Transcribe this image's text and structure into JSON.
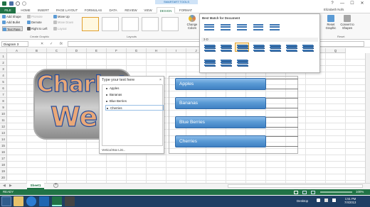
{
  "window": {
    "title": "Book1 - Excel",
    "context_tab_group": "SMARTART TOOLS",
    "user": "Elizabeth Nofs",
    "controls": [
      "?",
      "—",
      "☐",
      "✕"
    ]
  },
  "tabs": [
    "FILE",
    "HOME",
    "INSERT",
    "PAGE LAYOUT",
    "FORMULAS",
    "DATA",
    "REVIEW",
    "VIEW",
    "DESIGN",
    "FORMAT"
  ],
  "active_tab": "DESIGN",
  "ribbon": {
    "create_graphic": {
      "add_shape": "Add Shape",
      "add_bullet": "Add Bullet",
      "text_pane": "Text Pane",
      "promote": "Promote",
      "demote": "Demote",
      "right_to_left": "Right to Left",
      "layout": "Layout",
      "move_up": "Move Up",
      "move_down": "Move Down",
      "label": "Create Graphic"
    },
    "layouts_label": "Layouts",
    "change_colors": "Change Colors",
    "reset_graphic": "Reset Graphic",
    "convert_to_shapes": "Convert to Shapes",
    "reset_label": "Reset"
  },
  "styles_gallery": {
    "best_match_header": "Best Match for Document",
    "section_3d": "3-D"
  },
  "formula_bar": {
    "name_box": "Diagram 3",
    "fx": "fx",
    "cancel": "✕",
    "enter": "✓"
  },
  "columns": [
    "A",
    "B",
    "C",
    "D",
    "E",
    "F",
    "G",
    "H",
    "I",
    "J",
    "K",
    "L",
    "M",
    "N",
    "O",
    "P",
    "Q"
  ],
  "rows": [
    "1",
    "2",
    "3",
    "4",
    "5",
    "6",
    "7",
    "8",
    "9",
    "10",
    "11",
    "12",
    "13",
    "14",
    "15",
    "16",
    "17",
    "18",
    "19",
    "20"
  ],
  "logo_text": [
    "Charlott",
    "Webs"
  ],
  "text_pane": {
    "title": "Type your text here",
    "close": "×",
    "items": [
      "Apples",
      "Bananas",
      "Blue Berries",
      "Cherries"
    ],
    "footer": "Vertical Box List..."
  },
  "smartart": {
    "items": [
      "Apples",
      "Bananas",
      "Blue Berries",
      "Cherries"
    ]
  },
  "sheet": {
    "tab": "Sheet1",
    "add": "+"
  },
  "status": {
    "ready": "READY",
    "zoom": "100%"
  },
  "taskbar": {
    "desktop": "Desktop",
    "time": "1:51 PM",
    "date": "7/4/2013"
  },
  "colors": {
    "excel_green": "#217346",
    "smartart_blue": "#5b9bd5",
    "taskbar": "#1f3e63"
  }
}
